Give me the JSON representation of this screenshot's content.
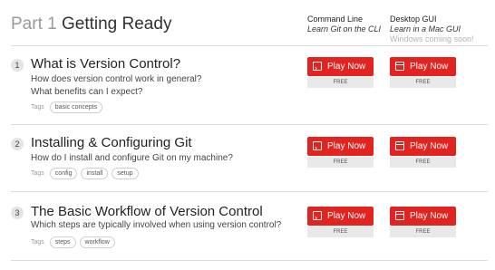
{
  "header": {
    "part_label": "Part 1",
    "part_name": "Getting Ready",
    "columns": [
      {
        "title": "Command Line",
        "subtitle": "Learn Git on the CLI",
        "note": ""
      },
      {
        "title": "Desktop GUI",
        "subtitle": "Learn in a Mac GUI",
        "note": "Windows coming soon!"
      }
    ]
  },
  "lessons": [
    {
      "number": "1",
      "title": "What is Version Control?",
      "description": [
        "How does version control work in general?",
        "What benefits can I expect?"
      ],
      "tags_label": "Tags",
      "tags": [
        "basic concepts"
      ],
      "cli": {
        "label": "Play Now",
        "price": "FREE"
      },
      "gui": {
        "label": "Play Now",
        "price": "FREE"
      }
    },
    {
      "number": "2",
      "title": "Installing & Configuring Git",
      "description": [
        "How do I install and configure Git on my machine?"
      ],
      "tags_label": "Tags",
      "tags": [
        "config",
        "install",
        "setup"
      ],
      "cli": {
        "label": "Play Now",
        "price": "FREE"
      },
      "gui": {
        "label": "Play Now",
        "price": "FREE"
      }
    },
    {
      "number": "3",
      "title": "The Basic Workflow of Version Control",
      "description": [
        "Which steps are typically involved when using version control?"
      ],
      "tags_label": "Tags",
      "tags": [
        "steps",
        "workflow"
      ],
      "cli": {
        "label": "Play Now",
        "price": "FREE"
      },
      "gui": {
        "label": "Play Now",
        "price": "FREE"
      }
    }
  ],
  "icons": {
    "cli": "terminal-icon",
    "gui": "window-icon"
  },
  "colors": {
    "accent": "#e2231f",
    "free_bg": "#e9e9e9",
    "divider": "#dddddd"
  }
}
